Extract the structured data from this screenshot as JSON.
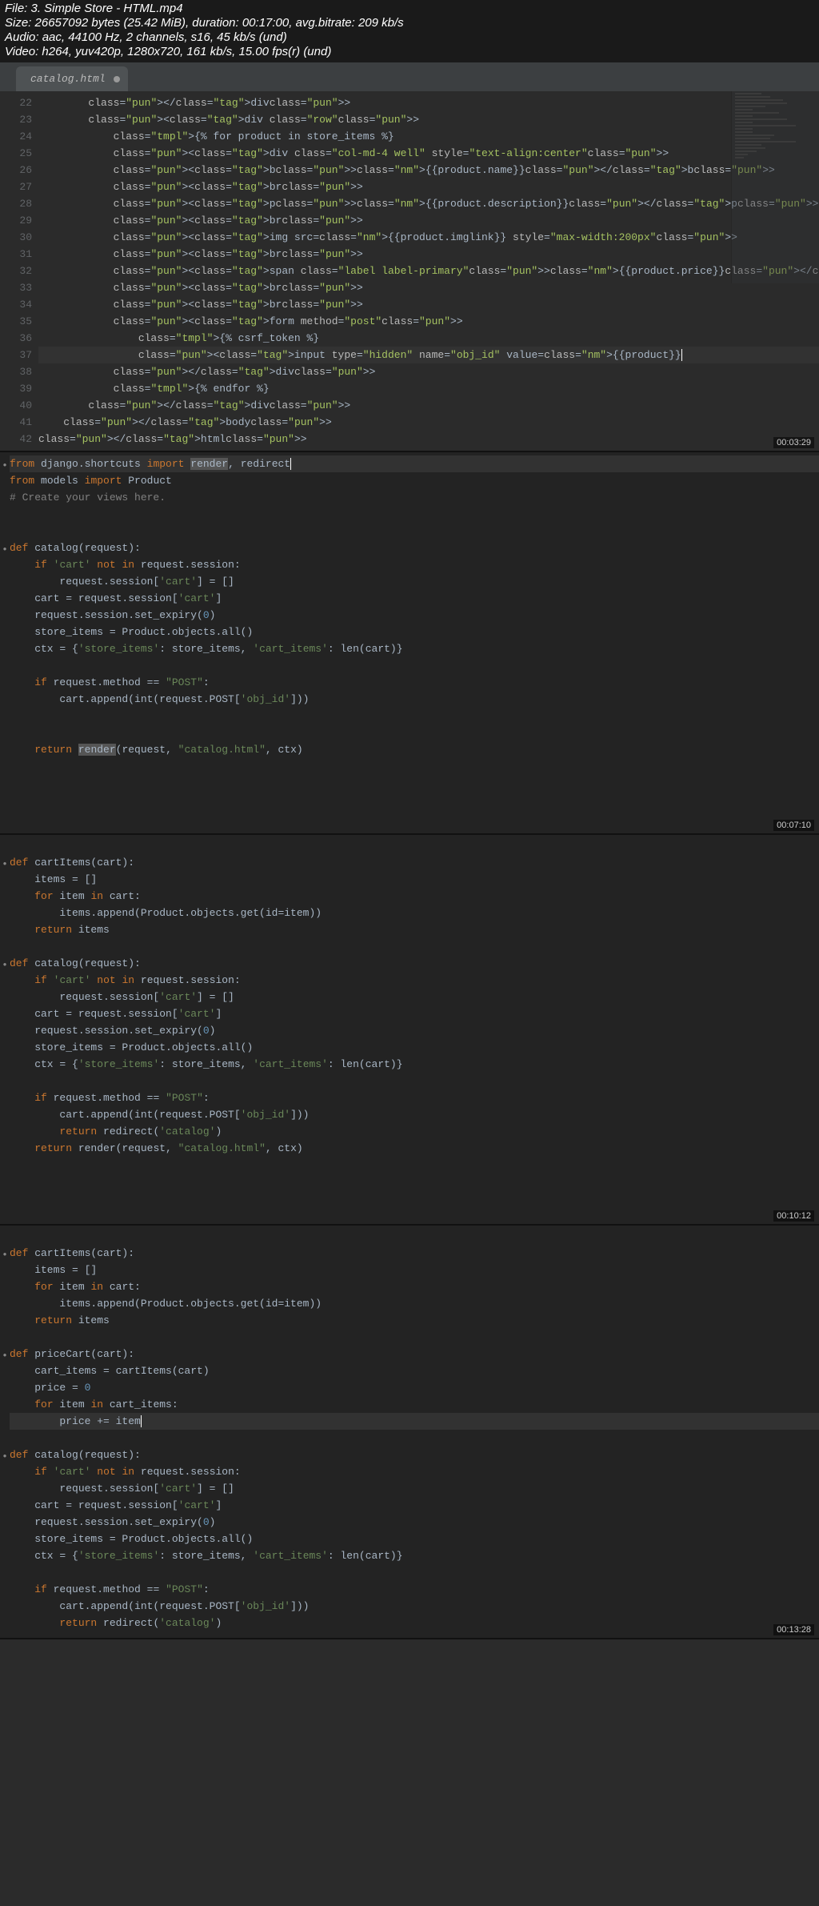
{
  "meta": {
    "line1": "File: 3. Simple Store - HTML.mp4",
    "line2": "Size: 26657092 bytes (25.42 MiB), duration: 00:17:00, avg.bitrate: 209 kb/s",
    "line3": "Audio: aac, 44100 Hz, 2 channels, s16, 45 kb/s (und)",
    "line4": "Video: h264, yuv420p, 1280x720, 161 kb/s, 15.00 fps(r) (und)"
  },
  "tab": {
    "name": "catalog.html"
  },
  "timestamps": {
    "p1": "00:03:29",
    "p2": "00:07:10",
    "p3": "00:10:12",
    "p4": "00:13:28"
  },
  "panel1": {
    "first_line": 22,
    "lines": [
      "        </div>",
      "        <div class = \"row\">",
      "            {% for product in store_items %}",
      "            <div class=\"col-md-4 well\" style=\"text-align:center\">",
      "            <b>{{product.name}}</b>",
      "            <br>",
      "            <p>{{product.description}}</p>",
      "            <br>",
      "            <img src={{product.imglink}} style=\"max-width:200px\">",
      "            <br>",
      "            <span class = \"label label-primary\">{{product.price}}</span>",
      "            <br>",
      "            <br>",
      "            <form method = \"post\">",
      "                {% csrf_token %}",
      "                <input type=\"hidden\" name=\"obj_id\" value={{product}}",
      "            </div>",
      "            {% endfor %}",
      "        </div>",
      "    </body>",
      "</html>"
    ]
  },
  "panel2": {
    "lines": [
      "from django.shortcuts import render, redirect",
      "from models import Product",
      "# Create your views here.",
      "",
      "",
      "def catalog(request):",
      "    if 'cart' not in request.session:",
      "        request.session['cart'] = []",
      "    cart = request.session['cart']",
      "    request.session.set_expiry(0)",
      "    store_items = Product.objects.all()",
      "    ctx = {'store_items': store_items, 'cart_items': len(cart)}",
      "",
      "    if request.method == \"POST\":",
      "        cart.append(int(request.POST['obj_id']))",
      "",
      "",
      "    return render(request, \"catalog.html\", ctx)"
    ]
  },
  "panel3": {
    "lines": [
      "def cartItems(cart):",
      "    items = []",
      "    for item in cart:",
      "        items.append(Product.objects.get(id=item))",
      "    return items",
      "",
      "def catalog(request):",
      "    if 'cart' not in request.session:",
      "        request.session['cart'] = []",
      "    cart = request.session['cart']",
      "    request.session.set_expiry(0)",
      "    store_items = Product.objects.all()",
      "    ctx = {'store_items': store_items, 'cart_items': len(cart)}",
      "",
      "    if request.method == \"POST\":",
      "        cart.append(int(request.POST['obj_id']))",
      "        return redirect('catalog')",
      "    return render(request, \"catalog.html\", ctx)"
    ]
  },
  "panel4": {
    "lines": [
      "def cartItems(cart):",
      "    items = []",
      "    for item in cart:",
      "        items.append(Product.objects.get(id=item))",
      "    return items",
      "",
      "def priceCart(cart):",
      "    cart_items = cartItems(cart)",
      "    price = 0",
      "    for item in cart_items:",
      "        price += item",
      "",
      "def catalog(request):",
      "    if 'cart' not in request.session:",
      "        request.session['cart'] = []",
      "    cart = request.session['cart']",
      "    request.session.set_expiry(0)",
      "    store_items = Product.objects.all()",
      "    ctx = {'store_items': store_items, 'cart_items': len(cart)}",
      "",
      "    if request.method == \"POST\":",
      "        cart.append(int(request.POST['obj_id']))",
      "        return redirect('catalog')"
    ]
  }
}
